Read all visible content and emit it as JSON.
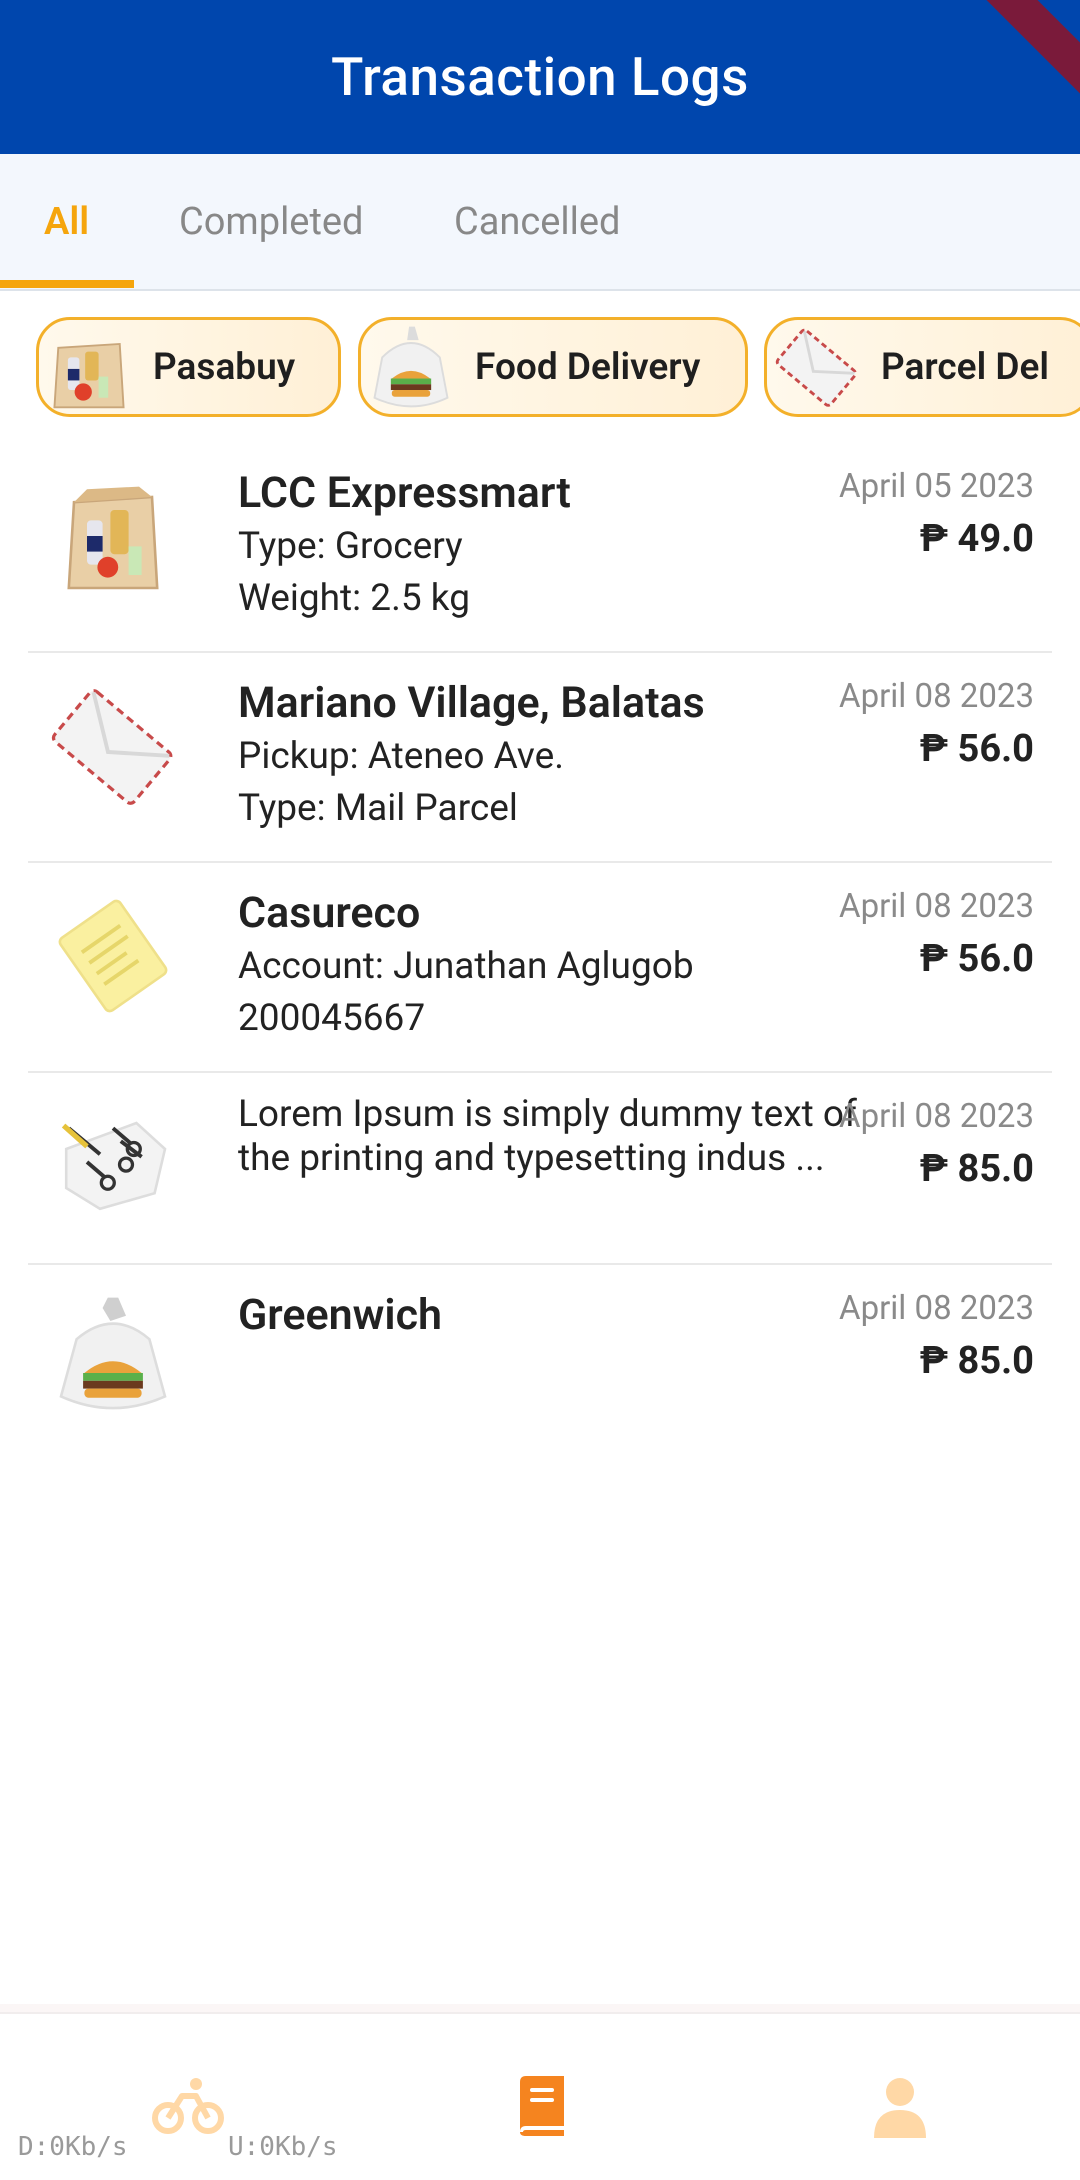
{
  "app": {
    "title": "Transaction Logs"
  },
  "tabs": [
    {
      "label": "All",
      "active": true
    },
    {
      "label": "Completed",
      "active": false
    },
    {
      "label": "Cancelled",
      "active": false
    }
  ],
  "categories": [
    {
      "label": "Pasabuy",
      "icon": "grocery-bag-icon"
    },
    {
      "label": "Food Delivery",
      "icon": "burger-icon"
    },
    {
      "label": "Parcel Del",
      "icon": "mail-envelope-icon"
    }
  ],
  "transactions": [
    {
      "title": "LCC Expressmart",
      "line1": "Type: Grocery",
      "line2": "Weight: 2.5 kg",
      "date": "April 05 2023",
      "price": "₱ 49.0",
      "icon": "grocery-bag-icon"
    },
    {
      "title": "Mariano Village, Balatas",
      "line1": "Pickup: Ateneo Ave.",
      "line2": "Type: Mail Parcel",
      "date": "April 08 2023",
      "price": "₱ 56.0",
      "icon": "mail-envelope-icon"
    },
    {
      "title": "Casureco",
      "line1": "Account: Junathan Aglugob",
      "line2": "200045667",
      "date": "April 08 2023",
      "price": "₱ 56.0",
      "icon": "bill-icon"
    },
    {
      "description": "Lorem Ipsum is simply dummy text of the printing and typesetting indus ...",
      "date": "April 08 2023",
      "price": "₱ 85.0",
      "icon": "errand-checklist-icon"
    },
    {
      "title": "Greenwich",
      "date": "April 08 2023",
      "price": "₱ 85.0",
      "icon": "burger-icon"
    }
  ],
  "bottom_nav": [
    {
      "name": "rider",
      "icon": "bike-icon",
      "active": false
    },
    {
      "name": "logs",
      "icon": "book-icon",
      "active": true
    },
    {
      "name": "profile",
      "icon": "person-icon",
      "active": false
    }
  ],
  "status": {
    "download": "D:0Kb/s",
    "upload": "U:0Kb/s"
  },
  "colors": {
    "primary": "#0046ad",
    "accent": "#f5a50d",
    "inactive": "#ffd8a6"
  }
}
